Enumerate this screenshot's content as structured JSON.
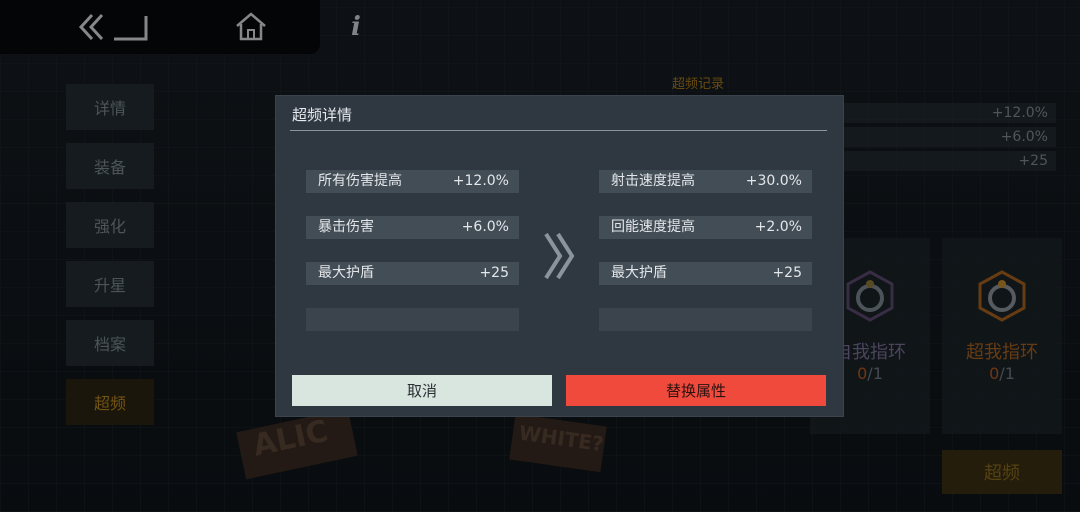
{
  "nav": {
    "back_icon": "double-chevron-back-icon",
    "home_icon": "home-icon",
    "info_symbol": "i"
  },
  "sidebar": {
    "tabs": [
      {
        "label": "详情"
      },
      {
        "label": "装备"
      },
      {
        "label": "强化"
      },
      {
        "label": "升星"
      },
      {
        "label": "档案"
      },
      {
        "label": "超频"
      }
    ],
    "active_index": 5
  },
  "background_panel": {
    "record_title": "超频记录",
    "stats": [
      "+12.0%",
      "+6.0%",
      "+25"
    ],
    "rings": [
      {
        "name": "自我指环",
        "count_current": "0",
        "count_total": "/1"
      },
      {
        "name": "超我指环",
        "count_current": "0",
        "count_total": "/1"
      }
    ],
    "overclock_button": "超频"
  },
  "character_signs": [
    "ALIC",
    "WHITE?"
  ],
  "modal": {
    "title": "超频详情",
    "current_attrs": [
      {
        "name": "所有伤害提高",
        "value": "+12.0%"
      },
      {
        "name": "暴击伤害",
        "value": "+6.0%"
      },
      {
        "name": "最大护盾",
        "value": "+25"
      }
    ],
    "new_attrs": [
      {
        "name": "射击速度提高",
        "value": "+30.0%"
      },
      {
        "name": "回能速度提高",
        "value": "+2.0%"
      },
      {
        "name": "最大护盾",
        "value": "+25"
      }
    ],
    "cancel_label": "取消",
    "replace_label": "替换属性"
  },
  "colors": {
    "accent_gold": "#b8871f",
    "replace_red": "#ef4a3c",
    "cancel_mint": "#d9e6df"
  }
}
